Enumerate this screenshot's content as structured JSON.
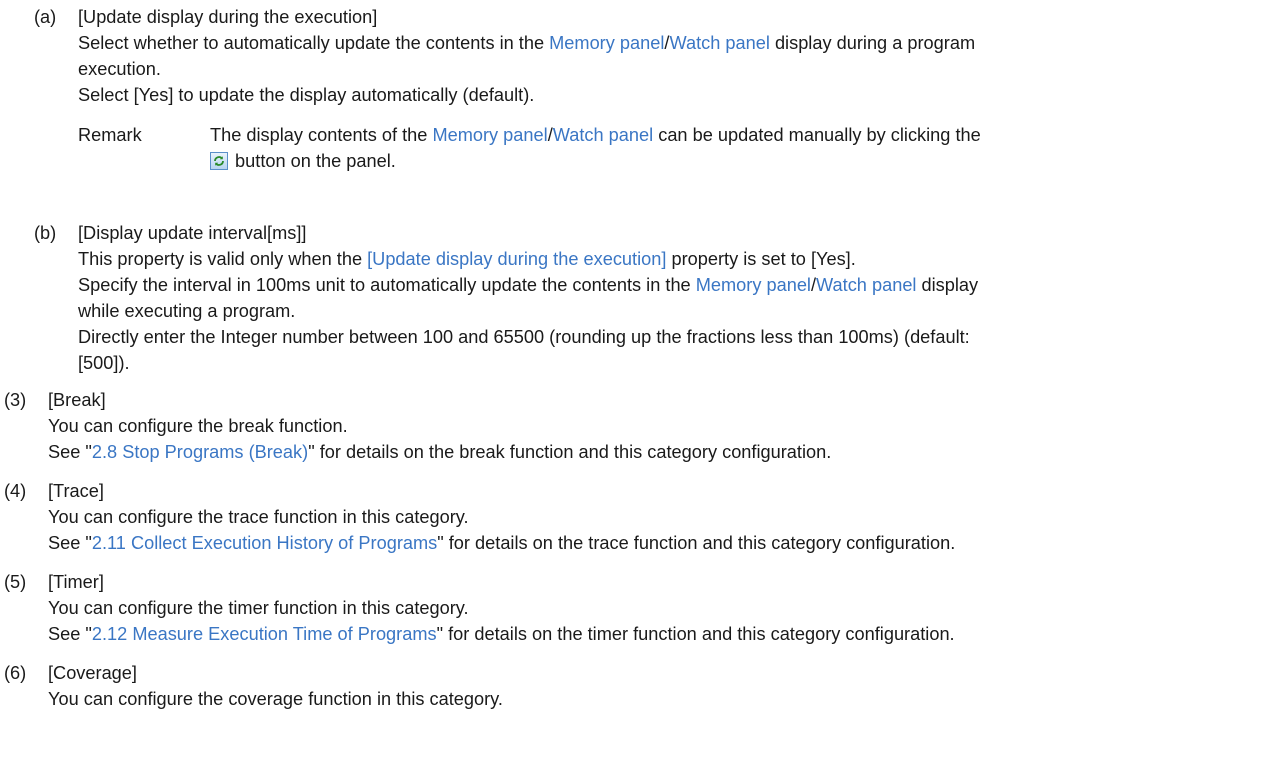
{
  "a": {
    "num": "(a)",
    "title": "[Update display during the execution]",
    "l1_pre": "Select whether to automatically update the contents in the ",
    "memory_panel": "Memory panel",
    "slash": "/",
    "watch_panel": "Watch panel",
    "l1_post": " display during a program",
    "l2": "execution.",
    "l3": "Select [Yes] to update the display automatically (default).",
    "remark_label": "Remark",
    "remark_pre": "The display contents of the ",
    "remark_post": " can be updated manually by clicking the",
    "remark_l2": " button on the panel."
  },
  "b": {
    "num": "(b)",
    "title": "[Display update interval[ms]]",
    "l1_pre": "This property is valid only when the ",
    "l1_link": "[Update display during the execution]",
    "l1_post": " property is set to [Yes].",
    "l2_pre": "Specify the interval in 100ms unit to automatically update the contents in the ",
    "l2_post": " display",
    "l3": "while executing a program.",
    "l4": "Directly enter the Integer number between 100 and 65500 (rounding up the fractions less than 100ms) (default:",
    "l5": "[500])."
  },
  "s3": {
    "num": "(3)",
    "title": "[Break]",
    "l1": "You can configure the break function.",
    "l2_pre": "See \"",
    "link": "2.8  Stop Programs (Break)",
    "l2_post": "\" for details on the break function and this category configuration."
  },
  "s4": {
    "num": "(4)",
    "title": "[Trace]",
    "l1": "You can configure the trace function in this category.",
    "l2_pre": "See \"",
    "link": "2.11  Collect Execution History of Programs",
    "l2_post": "\" for details on the trace function and this category configuration."
  },
  "s5": {
    "num": "(5)",
    "title": "[Timer]",
    "l1": "You can configure the timer function in this category.",
    "l2_pre": "See \"",
    "link": "2.12  Measure Execution Time of Programs",
    "l2_post": "\" for details on the timer function and this category configuration."
  },
  "s6": {
    "num": "(6)",
    "title": "[Coverage]",
    "l1": "You can configure the coverage function in this category."
  },
  "colors": {
    "link": "#3a76c4",
    "text": "#1a1a1a"
  },
  "icons": {
    "refresh": "refresh-icon"
  }
}
